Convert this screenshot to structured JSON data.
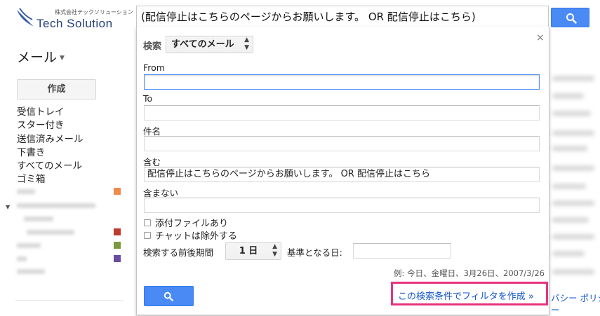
{
  "logo": {
    "company_small": "株式会社テックソリューション",
    "company_name": "Tech Solution"
  },
  "search": {
    "query": "(配信停止はこちらのページからお願いします。 OR 配信停止はこちら)"
  },
  "sidebar": {
    "title": "メール",
    "compose_label": "作成",
    "items": [
      "受信トレイ",
      "スター付き",
      "送信済みメール",
      "下書き",
      "すべてのメール",
      "ゴミ箱"
    ],
    "label_colors": [
      "#f08a4b",
      "#c0392b",
      "#7a9a3b",
      "#6a4ca0"
    ]
  },
  "filter_panel": {
    "search_label": "検索",
    "scope_value": "すべてのメール",
    "from_label": "From",
    "from_value": "",
    "to_label": "To",
    "to_value": "",
    "subject_label": "件名",
    "subject_value": "",
    "has_words_label": "含む",
    "has_words_value": "配信停止はこちらのページからお願いします。 OR 配信停止はこちら",
    "no_words_label": "含まない",
    "no_words_value": "",
    "has_attachment_label": "添付ファイルあり",
    "exclude_chats_label": "チャットは除外する",
    "date_within_label": "検索する前後期間",
    "date_within_value": "1 日",
    "date_of_label": "基準となる日:",
    "date_of_value": "",
    "example_text": "例: 今日、金曜日、3月26日、2007/3/26",
    "create_filter_link": "この検索条件でフィルタを作成 »",
    "close_glyph": "×"
  },
  "footer": {
    "policy_text": "バシー ポリシ",
    "policy_text2": "ー"
  }
}
